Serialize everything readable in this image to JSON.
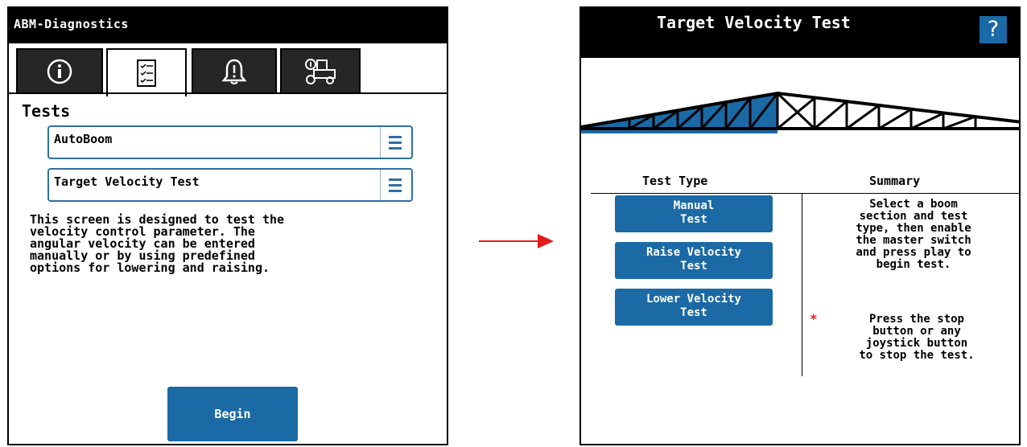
{
  "left_screen": {
    "title": "ABM-Diagnostics",
    "tabs": [
      {
        "icon": "info-icon",
        "active": false
      },
      {
        "icon": "checklist-icon",
        "active": true
      },
      {
        "icon": "alarm-bell-icon",
        "active": false
      },
      {
        "icon": "machine-settings-icon",
        "active": false
      }
    ],
    "tests_heading": "Tests",
    "system_select": {
      "value": "AutoBoom",
      "icon": "menu-icon"
    },
    "test_select": {
      "value": "Target Velocity Test",
      "icon": "menu-icon"
    },
    "description": "This screen is designed to test the\nvelocity control parameter. The\nangular velocity can be entered\nmanually or by using predefined\noptions for lowering and raising.",
    "begin_label": "Begin"
  },
  "arrow": {
    "color": "#e21b1b"
  },
  "right_screen": {
    "title": "Target Velocity Test",
    "help_label": "?",
    "columns": {
      "test_type": "Test Type",
      "summary": "Summary"
    },
    "buttons": [
      "Manual\nTest",
      "Raise Velocity\nTest",
      "Lower Velocity\nTest"
    ],
    "summary": "Select a boom\nsection and test\ntype, then enable\nthe master switch\nand press play to\nbegin test.",
    "note_marker": "*",
    "note": "Press the stop\nbutton or any\njoystick button\nto stop the test."
  },
  "colors": {
    "accent": "#1b6aa6",
    "title_bar": "#000000",
    "tab_inactive": "#262626",
    "arrow": "#e21b1b"
  }
}
